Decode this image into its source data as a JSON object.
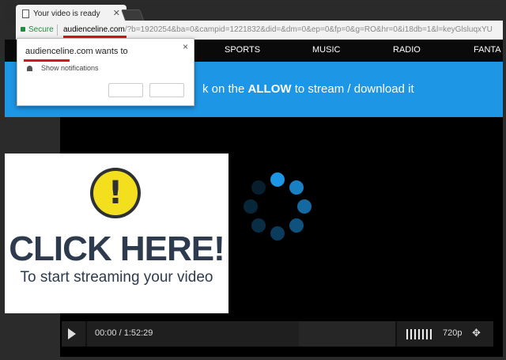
{
  "browser": {
    "tab_title": "Your video is ready",
    "tab_close": "✕",
    "secure_label": "Secure",
    "url_domain": "audienceline.com",
    "url_rest": "/?b=1920254&ba=0&campid=1221832&did=&dm=0&ep=0&fp=0&g=RO&hr=0&i18db=1&l=keyGlsluqxYU"
  },
  "notification_popup": {
    "title": "audienceline.com wants to",
    "permission": "Show notifications",
    "close": "×",
    "icon": "bell-icon"
  },
  "nav": {
    "items": [
      "SPORTS",
      "MUSIC",
      "RADIO",
      "FANTA"
    ]
  },
  "banner": {
    "text_before": "k on the ",
    "text_bold": "ALLOW",
    "text_after": " to stream / download it",
    "color": "#1e96e6"
  },
  "ad": {
    "warning_mark": "!",
    "title": "CLICK HERE!",
    "subtitle": "To start streaming your video",
    "icon": "warning-icon"
  },
  "player": {
    "time": "00:00 / 1:52:29",
    "quality": "720p",
    "expand": "✥",
    "spinner_color": "#1e96e6"
  }
}
